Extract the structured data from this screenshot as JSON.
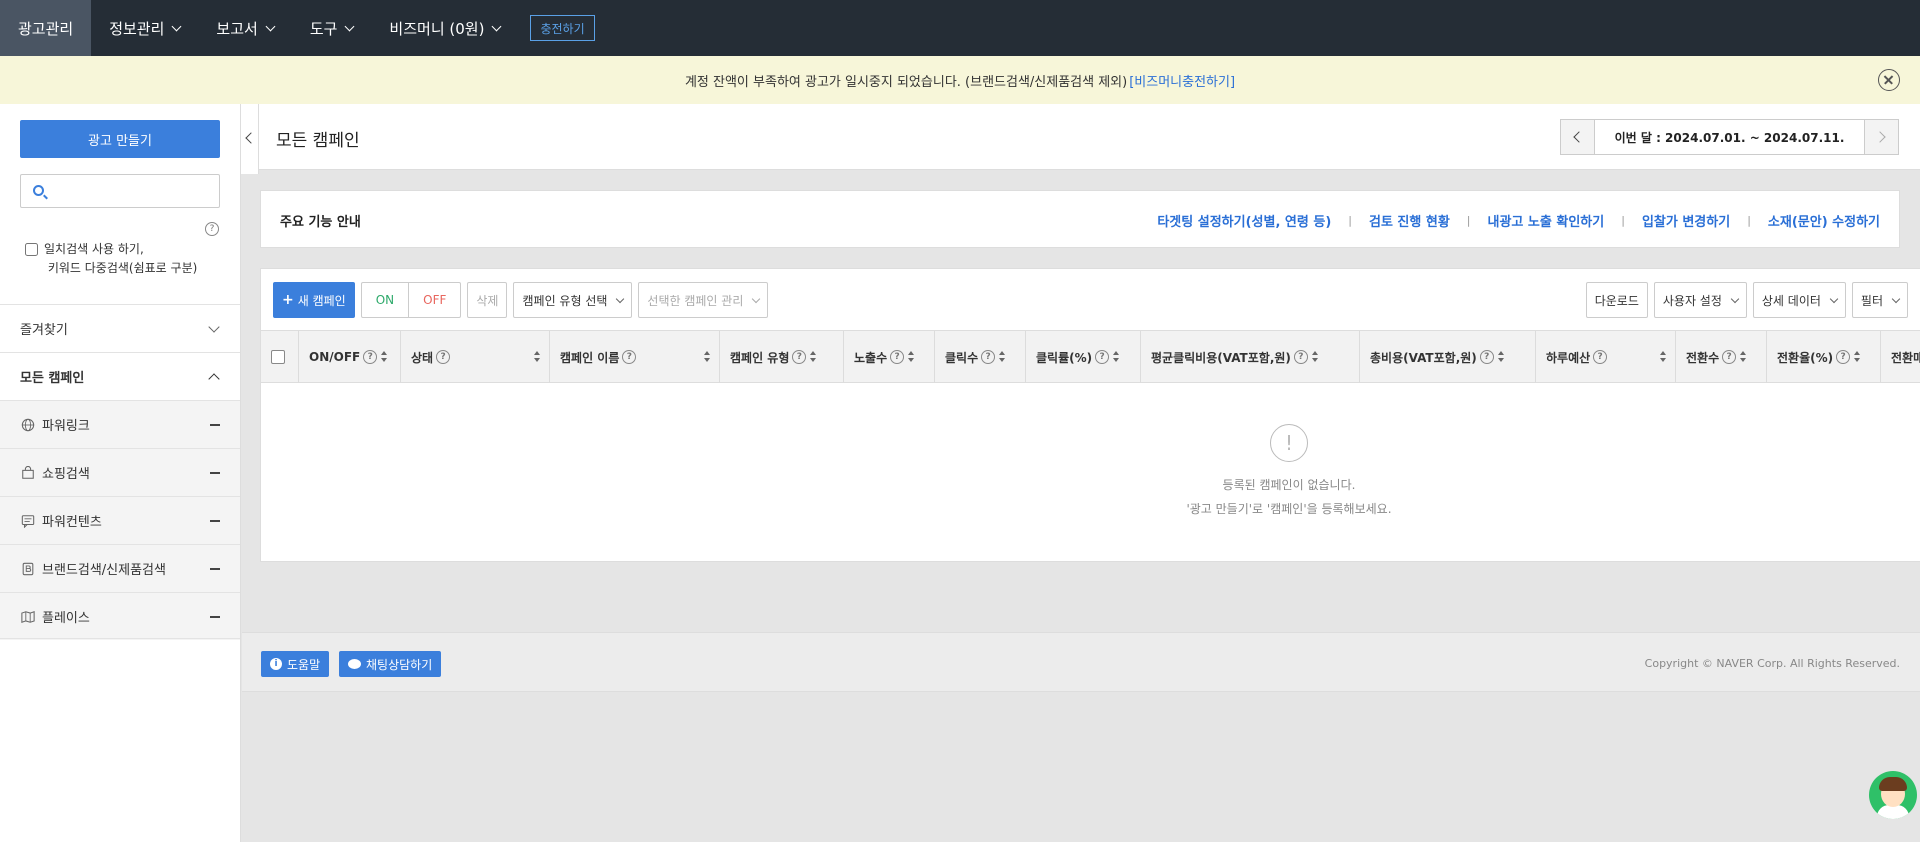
{
  "topnav": {
    "items": [
      {
        "label": "광고관리",
        "active": true
      },
      {
        "label": "정보관리"
      },
      {
        "label": "보고서"
      },
      {
        "label": "도구"
      },
      {
        "label": "비즈머니 (0원)"
      }
    ],
    "charge_button": "충전하기"
  },
  "banner": {
    "text": "계정 잔액이 부족하여 광고가 일시중지 되었습니다. (브랜드검색/신제품검색 제외)",
    "link": "[비즈머니충전하기]"
  },
  "sidebar": {
    "create_button": "광고 만들기",
    "search_placeholder": "",
    "help": "?",
    "checkbox_label_1": "일치검색 사용 하기,",
    "checkbox_label_2": "키워드 다중검색(쉼표로 구분)",
    "favorites": "즐겨찾기",
    "all_campaigns": "모든 캠페인",
    "campaign_types": [
      {
        "label": "파워링크",
        "icon": "globe-icon"
      },
      {
        "label": "쇼핑검색",
        "icon": "shopping-bag-icon"
      },
      {
        "label": "파워컨텐츠",
        "icon": "content-icon"
      },
      {
        "label": "브랜드검색/신제품검색",
        "icon": "brand-icon"
      },
      {
        "label": "플레이스",
        "icon": "map-icon"
      }
    ]
  },
  "page": {
    "title": "모든 캠페인",
    "date_range": "이번 달 : 2024.07.01. ~ 2024.07.11."
  },
  "guide": {
    "title": "주요 기능 안내",
    "links": [
      "타겟팅 설정하기(성별, 연령 등)",
      "검토 진행 현황",
      "내광고 노출 확인하기",
      "입찰가 변경하기",
      "소재(문안) 수정하기"
    ]
  },
  "toolbar": {
    "new_campaign": "새 캠페인",
    "on": "ON",
    "off": "OFF",
    "delete": "삭제",
    "campaign_type_select": "캠페인 유형 선택",
    "manage_selected": "선택한 캠페인 관리",
    "download": "다운로드",
    "user_settings": "사용자 설정",
    "detail_data": "상세 데이터",
    "filter": "필터"
  },
  "grid": {
    "columns": [
      "ON/OFF",
      "상태",
      "캠페인 이름",
      "캠페인 유형",
      "노출수",
      "클릭수",
      "클릭률(%)",
      "평균클릭비용(VAT포함,원)",
      "총비용(VAT포함,원)",
      "하루예산",
      "전환수",
      "전환율(%)",
      "전환매출액"
    ],
    "empty_line_1": "등록된 캠페인이 없습니다.",
    "empty_line_2": "'광고 만들기'로 '캠페인'을 등록해보세요."
  },
  "footer": {
    "help_button": "도움말",
    "chat_button": "채팅상담하기",
    "copyright": "Copyright © NAVER Corp. All Rights Reserved."
  },
  "colors": {
    "nav_bg": "#252d36",
    "accent": "#3b7fdc",
    "banner_bg": "#f7f6d9",
    "link": "#2a6fd6"
  }
}
